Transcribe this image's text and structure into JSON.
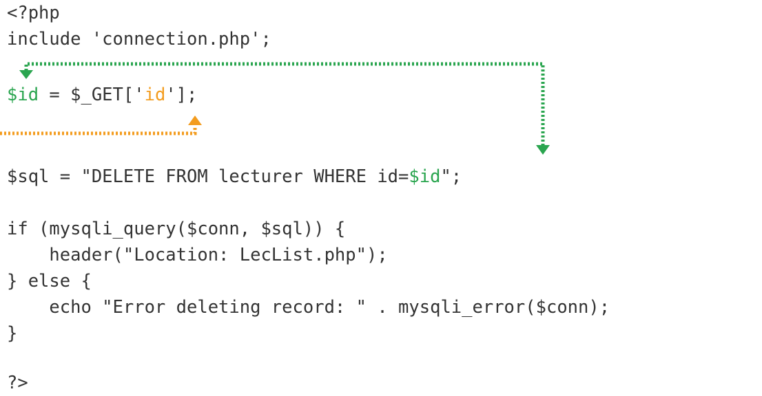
{
  "code": {
    "line1": "<?php",
    "line2": "include 'connection.php';",
    "line3": {
      "var": "$id",
      "mid": " = $_GET['",
      "key": "id",
      "end": "'];"
    },
    "line4": {
      "start": "$sql = \"DELETE FROM lecturer WHERE id=",
      "var": "$id",
      "end": "\";"
    },
    "line5": "if (mysqli_query($conn, $sql)) {",
    "line6": "    header(\"Location: LecList.php\");",
    "line7": "} else {",
    "line8": "    echo \"Error deleting record: \" . mysqli_error($conn);",
    "line9": "}",
    "line10": "?>"
  },
  "colors": {
    "text": "#333333",
    "green": "#2aa54f",
    "orange": "#f39c1e"
  },
  "icons": [
    "arrow-down-green-icon",
    "arrow-up-orange-icon"
  ]
}
